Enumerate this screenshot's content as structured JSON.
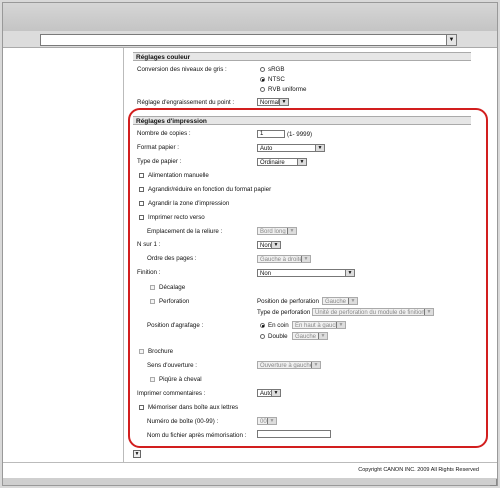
{
  "footer": {
    "copyright": "Copyright CANON INC. 2009 All Rights Reserved"
  },
  "couleur": {
    "title": "Réglages couleur",
    "gris_label": "Conversion des niveaux de gris :",
    "gris_options": [
      "sRGB",
      "NTSC",
      "RVB uniforme"
    ],
    "gris_selected": "NTSC",
    "engraissement_label": "Réglage d'engraissement du point :",
    "engraissement_value": "Normal"
  },
  "impression": {
    "title": "Réglages d'impression",
    "copies_label": "Nombre de copies :",
    "copies_value": "1",
    "copies_range": "(1- 9999)",
    "format_label": "Format papier :",
    "format_value": "Auto",
    "type_label": "Type de papier :",
    "type_value": "Ordinaire",
    "alim_label": "Alimentation manuelle",
    "agrandir_label": "Agrandir/réduire en fonction du format papier",
    "zone_label": "Agrandir la zone d'impression",
    "recto_label": "Imprimer recto verso",
    "reliure_label": "Emplacement de la reliure :",
    "reliure_value": "Bord long",
    "nsur1_label": "N sur 1 :",
    "nsur1_value": "Non",
    "ordre_label": "Ordre des pages :",
    "ordre_value": "Gauche à droite",
    "finition_label": "Finition :",
    "finition_value": "Non",
    "decalage_label": "Décalage",
    "perforation_label": "Perforation",
    "pos_perf_label": "Position de perforation",
    "pos_perf_value": "Gauche",
    "type_perf_label": "Type de perforation",
    "type_perf_value": "Unité de perforation du module de finition",
    "agrafage_label": "Position d'agrafage :",
    "en_coin_label": "En coin",
    "en_coin_value": "En haut à gauche",
    "double_label": "Double",
    "double_value": "Gauche",
    "brochure_label": "Brochure",
    "sens_label": "Sens d'ouverture :",
    "sens_value": "Ouverture à gauche",
    "piqure_label": "Piqûre à cheval",
    "commentaires_label": "Imprimer commentaires :",
    "commentaires_value": "Auto",
    "memoriser_label": "Mémoriser dans boîte aux lettres",
    "numero_label": "Numéro de boîte (00-99) :",
    "numero_value": "00",
    "nom_fichier_label": "Nom du fichier après mémorisation :",
    "nom_fichier_value": ""
  }
}
